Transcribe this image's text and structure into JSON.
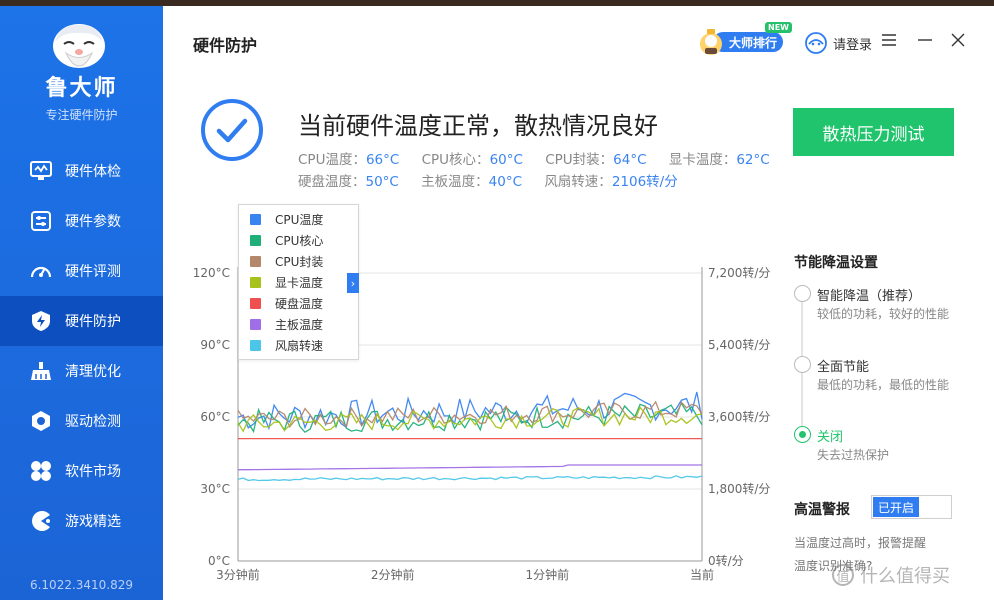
{
  "app": {
    "brand": "鲁大师",
    "tagline": "专注硬件防护",
    "version": "6.1022.3410.829"
  },
  "sidebar": {
    "items": [
      {
        "label": "硬件体检",
        "icon": "monitor-check-icon"
      },
      {
        "label": "硬件参数",
        "icon": "sliders-icon"
      },
      {
        "label": "硬件评测",
        "icon": "gauge-icon"
      },
      {
        "label": "硬件防护",
        "icon": "shield-bolt-icon",
        "active": true
      },
      {
        "label": "清理优化",
        "icon": "broom-icon"
      },
      {
        "label": "驱动检测",
        "icon": "gear-hex-icon"
      },
      {
        "label": "软件市场",
        "icon": "clover-icon"
      },
      {
        "label": "游戏精选",
        "icon": "pacman-icon"
      }
    ]
  },
  "header": {
    "title": "硬件防护",
    "rank_label": "大师排行",
    "new_tag": "NEW",
    "login_label": "请登录"
  },
  "status": {
    "title": "当前硬件温度正常，散热情况良好",
    "readings": [
      {
        "label": "CPU温度：",
        "value": "66°C"
      },
      {
        "label": "CPU核心：",
        "value": "60°C"
      },
      {
        "label": "CPU封装：",
        "value": "64°C"
      },
      {
        "label": "显卡温度：",
        "value": "62°C"
      },
      {
        "label": "硬盘温度：",
        "value": "50°C"
      },
      {
        "label": "主板温度：",
        "value": "40°C"
      },
      {
        "label": "风扇转速：",
        "value": "2106转/分"
      }
    ],
    "stress_button": "散热压力测试"
  },
  "chart_data": {
    "type": "line",
    "y_left_ticks": [
      "120°C",
      "90°C",
      "60°C",
      "30°C",
      "0°C"
    ],
    "y_right_ticks": [
      "7,200转/分",
      "5,400转/分",
      "3,600转/分",
      "1,800转/分",
      "0转/分"
    ],
    "x_ticks": [
      "3分钟前",
      "2分钟前",
      "1分钟前",
      "当前"
    ],
    "ylim_left": [
      0,
      120
    ],
    "ylim_right": [
      0,
      7200
    ],
    "series": [
      {
        "name": "CPU温度",
        "color": "#3a84f0",
        "base": 60,
        "noise": 6,
        "trend": 5
      },
      {
        "name": "CPU核心",
        "color": "#1fb079",
        "base": 58,
        "noise": 5,
        "trend": 3
      },
      {
        "name": "CPU封装",
        "color": "#b5876a",
        "base": 59,
        "noise": 4,
        "trend": 4
      },
      {
        "name": "显卡温度",
        "color": "#a7c21a",
        "base": 57,
        "noise": 4,
        "trend": 4
      },
      {
        "name": "硬盘温度",
        "color": "#ef4f4f",
        "base": 51,
        "noise": 0,
        "trend": 0
      },
      {
        "name": "主板温度",
        "color": "#a06ee6",
        "base": 38,
        "noise": 0,
        "trend": 2
      },
      {
        "name": "风扇转速",
        "color": "#4cc6e8",
        "base": 34,
        "noise": 0.6,
        "trend": 1
      }
    ]
  },
  "cooling": {
    "title": "节能降温设置",
    "options": [
      {
        "label": "智能降温（推荐）",
        "desc": "较低的功耗，较好的性能",
        "selected": false
      },
      {
        "label": "全面节能",
        "desc": "最低的功耗，最低的性能",
        "selected": false
      },
      {
        "label": "关闭",
        "desc": "失去过热保护",
        "selected": true
      }
    ]
  },
  "alarm": {
    "title": "高温警报",
    "toggle_label": "已开启",
    "desc_line1": "当温度过高时，报警提醒",
    "desc_line2": "温度识别准确?"
  },
  "watermark": {
    "text": "什么值得买",
    "glyph": "值"
  }
}
